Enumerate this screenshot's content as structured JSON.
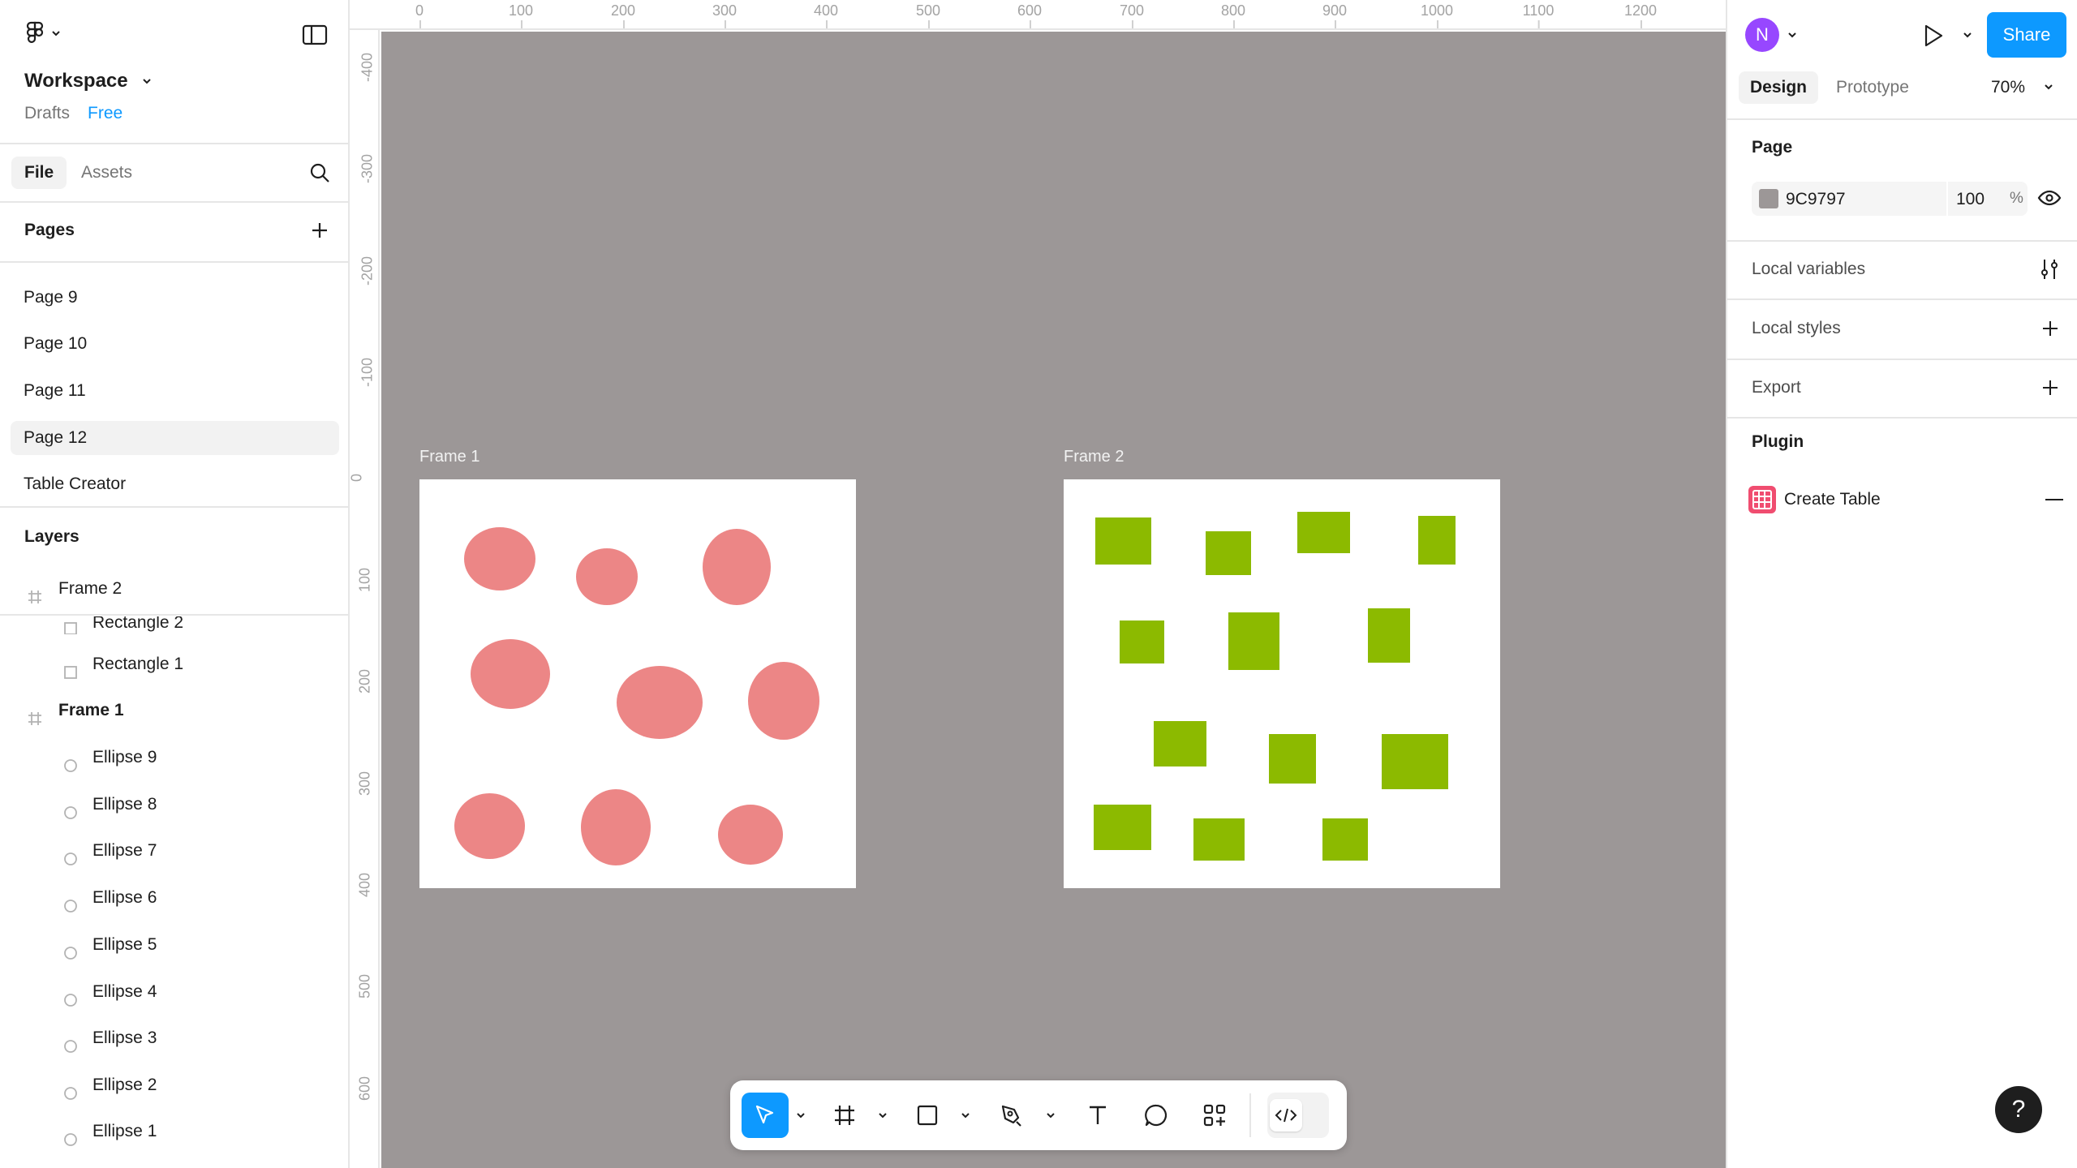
{
  "left_panel": {
    "workspace_name": "Workspace",
    "drafts_label": "Drafts",
    "plan_badge": "Free",
    "tabs": {
      "file": "File",
      "assets": "Assets"
    },
    "pages_header": "Pages",
    "pages": [
      "Page 9",
      "Page 10",
      "Page 11",
      "Page 12",
      "Table Creator"
    ],
    "selected_page": "Page 12",
    "layers_header": "Layers",
    "layers": {
      "frame2": "Frame 2",
      "rect2": "Rectangle 2",
      "rect1": "Rectangle 1",
      "frame1": "Frame 1",
      "ellipses": [
        "Ellipse 9",
        "Ellipse 8",
        "Ellipse 7",
        "Ellipse 6",
        "Ellipse 5",
        "Ellipse 4",
        "Ellipse 3",
        "Ellipse 2",
        "Ellipse 1"
      ]
    }
  },
  "ruler": {
    "x_ticks": [
      "0",
      "100",
      "200",
      "300",
      "400",
      "500",
      "600",
      "700",
      "800",
      "900",
      "1000",
      "1100",
      "1200"
    ],
    "y_ticks": [
      "-400",
      "-300",
      "-200",
      "-100",
      "0",
      "100",
      "200",
      "300",
      "400",
      "500",
      "600"
    ]
  },
  "canvas": {
    "background_color": "#9c9797",
    "frame1_label": "Frame 1",
    "frame2_label": "Frame 2",
    "ellipse_color": "#ec8686",
    "rect_color": "#8cba00"
  },
  "toolbar": {
    "tools": [
      "move-tool",
      "frame-tool",
      "shape-tool",
      "pen-tool",
      "text-tool",
      "comment-tool",
      "actions-tool",
      "dev-mode-toggle"
    ],
    "active_tool": "move-tool"
  },
  "right_panel": {
    "avatar_initial": "N",
    "share_label": "Share",
    "tabs": {
      "design": "Design",
      "prototype": "Prototype"
    },
    "zoom": "70%",
    "page_section": "Page",
    "page_color_hex": "9C9797",
    "page_opacity": "100",
    "percent_sign": "%",
    "local_variables": "Local variables",
    "local_styles": "Local styles",
    "export": "Export",
    "plugin_section": "Plugin",
    "plugin_name": "Create Table"
  },
  "help_label": "?"
}
